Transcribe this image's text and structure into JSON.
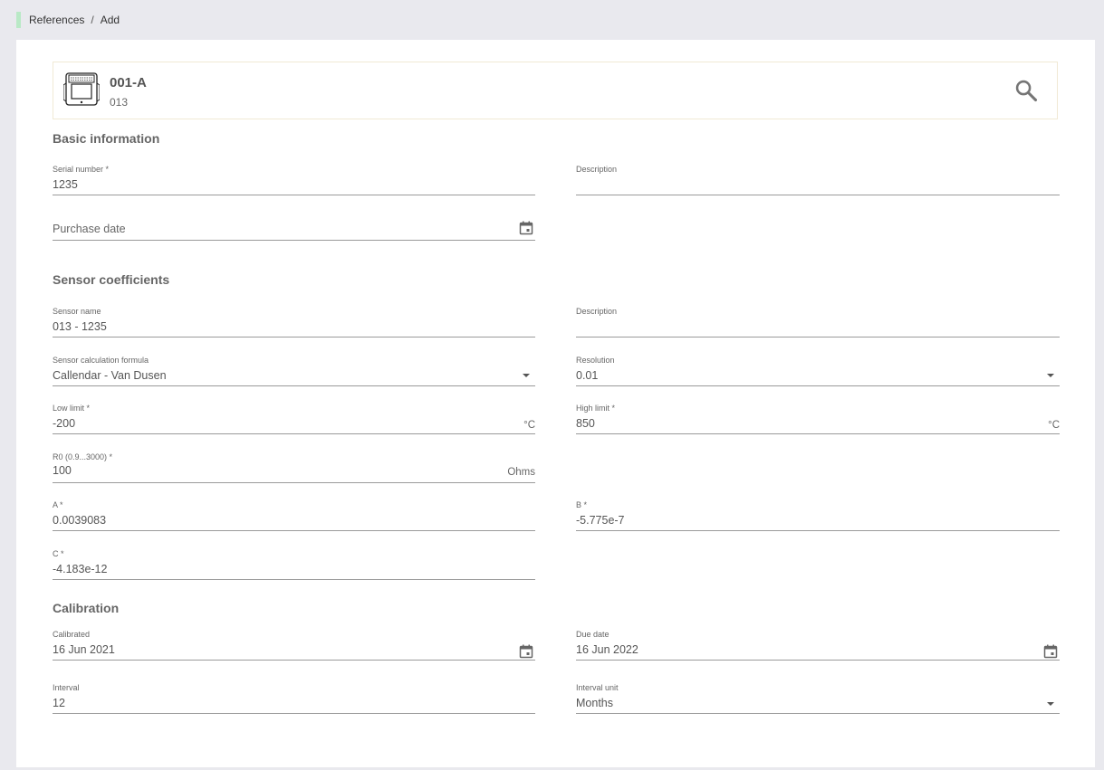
{
  "breadcrumb": {
    "root": "References",
    "separator": "/",
    "current": "Add"
  },
  "device": {
    "code": "001-A",
    "subtitle": "013",
    "image_icon": "thermometer-device-icon",
    "search_icon": "search-icon"
  },
  "sections": {
    "basic": "Basic information",
    "sensor": "Sensor coefficients",
    "calibration": "Calibration"
  },
  "basic": {
    "serial_label": "Serial number *",
    "serial_value": "1235",
    "description_label": "Description",
    "description_value": "",
    "purchase_placeholder": "Purchase date"
  },
  "sensor": {
    "name_label": "Sensor name",
    "name_value": "013 - 1235",
    "description_label": "Description",
    "description_value": "",
    "formula_label": "Sensor calculation formula",
    "formula_value": "Callendar - Van Dusen",
    "resolution_label": "Resolution",
    "resolution_value": "0.01",
    "low_label": "Low limit *",
    "low_value": "-200",
    "low_unit": "°C",
    "high_label": "High limit *",
    "high_value": "850",
    "high_unit": "°C",
    "r0_label": "R0 (0.9...3000) *",
    "r0_value": "100",
    "r0_unit": "Ohms",
    "a_label": "A *",
    "a_value": "0.0039083",
    "b_label": "B *",
    "b_value": "-5.775e-7",
    "c_label": "C *",
    "c_value": "-4.183e-12"
  },
  "calibration": {
    "calibrated_label": "Calibrated",
    "calibrated_value": "16 Jun 2021",
    "due_label": "Due date",
    "due_value": "16 Jun 2022",
    "interval_label": "Interval",
    "interval_value": "12",
    "unit_label": "Interval unit",
    "unit_value": "Months"
  }
}
